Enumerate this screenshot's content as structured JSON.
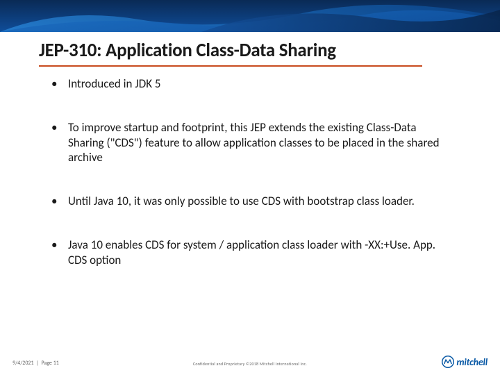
{
  "title": "JEP-310: Application Class-Data Sharing",
  "bullets": [
    "Introduced in JDK 5",
    "To improve startup and footprint, this JEP extends the existing Class-Data Sharing (\"CDS\") feature to allow application classes to be placed in the shared archive",
    "Until Java 10, it was only possible to use CDS with  bootstrap class loader.",
    "Java 10 enables CDS for system / application class loader with -XX:+Use. App. CDS option"
  ],
  "footer": {
    "date": "9/4/2021",
    "page": "Page 11",
    "confidential": "Confidential and Proprietary ©2018 Mitchell International Inc.",
    "brand": "mitchell"
  },
  "colors": {
    "accent": "#c84b1e",
    "brand": "#0b5aa6"
  }
}
